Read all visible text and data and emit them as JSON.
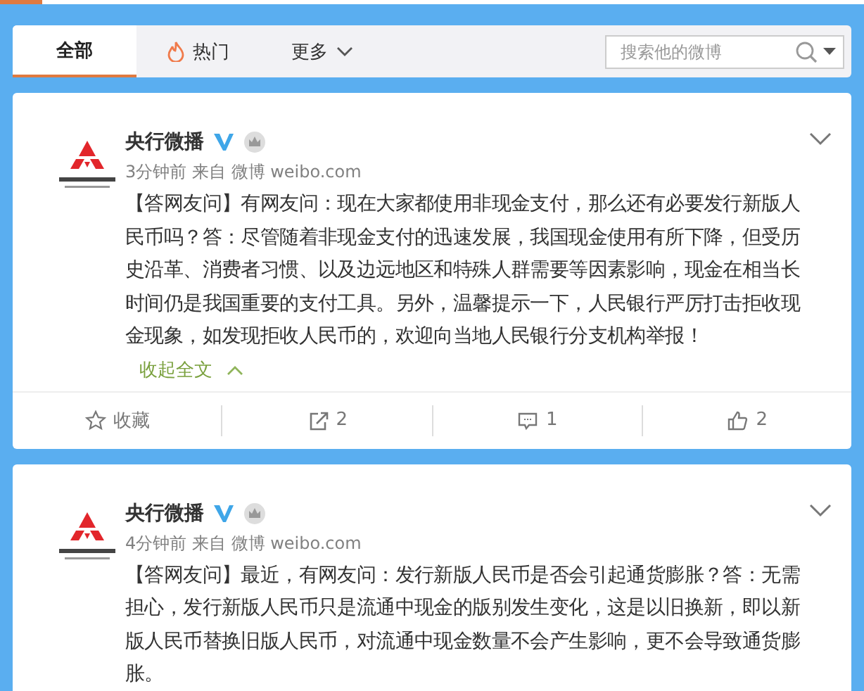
{
  "tabs": [
    {
      "label": "全部",
      "kind": "plain",
      "selected": true
    },
    {
      "label": "热门",
      "kind": "hot",
      "selected": false
    },
    {
      "label": "更多",
      "kind": "more",
      "selected": false
    }
  ],
  "search": {
    "placeholder": "搜索他的微博"
  },
  "posts": [
    {
      "author": "央行微播",
      "verified": true,
      "meta": "3分钟前 来自 微博 weibo.com",
      "text": "【答网友问】有网友问：现在大家都使用非现金支付，那么还有必要发行新版人民币吗？答：尽管随着非现金支付的迅速发展，我国现金使用有所下降，但受历史沿革、消费者习惯、以及边远地区和特殊人群需要等因素影响，现金在相当长时间仍是我国重要的支付工具。另外，温馨提示一下，人民银行严厉打击拒收现金现象，如发现拒收人民币的，欢迎向当地人民银行分支机构举报！",
      "collapse_link": "收起全文",
      "actions": [
        {
          "kind": "favorite",
          "label": "收藏"
        },
        {
          "kind": "repost",
          "label": "2"
        },
        {
          "kind": "comment",
          "label": "1"
        },
        {
          "kind": "like",
          "label": "2"
        }
      ]
    },
    {
      "author": "央行微播",
      "verified": true,
      "meta": "4分钟前 来自 微博 weibo.com",
      "text": "【答网友问】最近，有网友问：发行新版人民币是否会引起通货膨胀？答：无需担心，发行新版人民币只是流通中现金的版别发生变化，这是以旧换新，即以新版人民币替换旧版人民币，对流通中现金数量不会产生影响，更不会导致通货膨胀。"
    }
  ]
}
